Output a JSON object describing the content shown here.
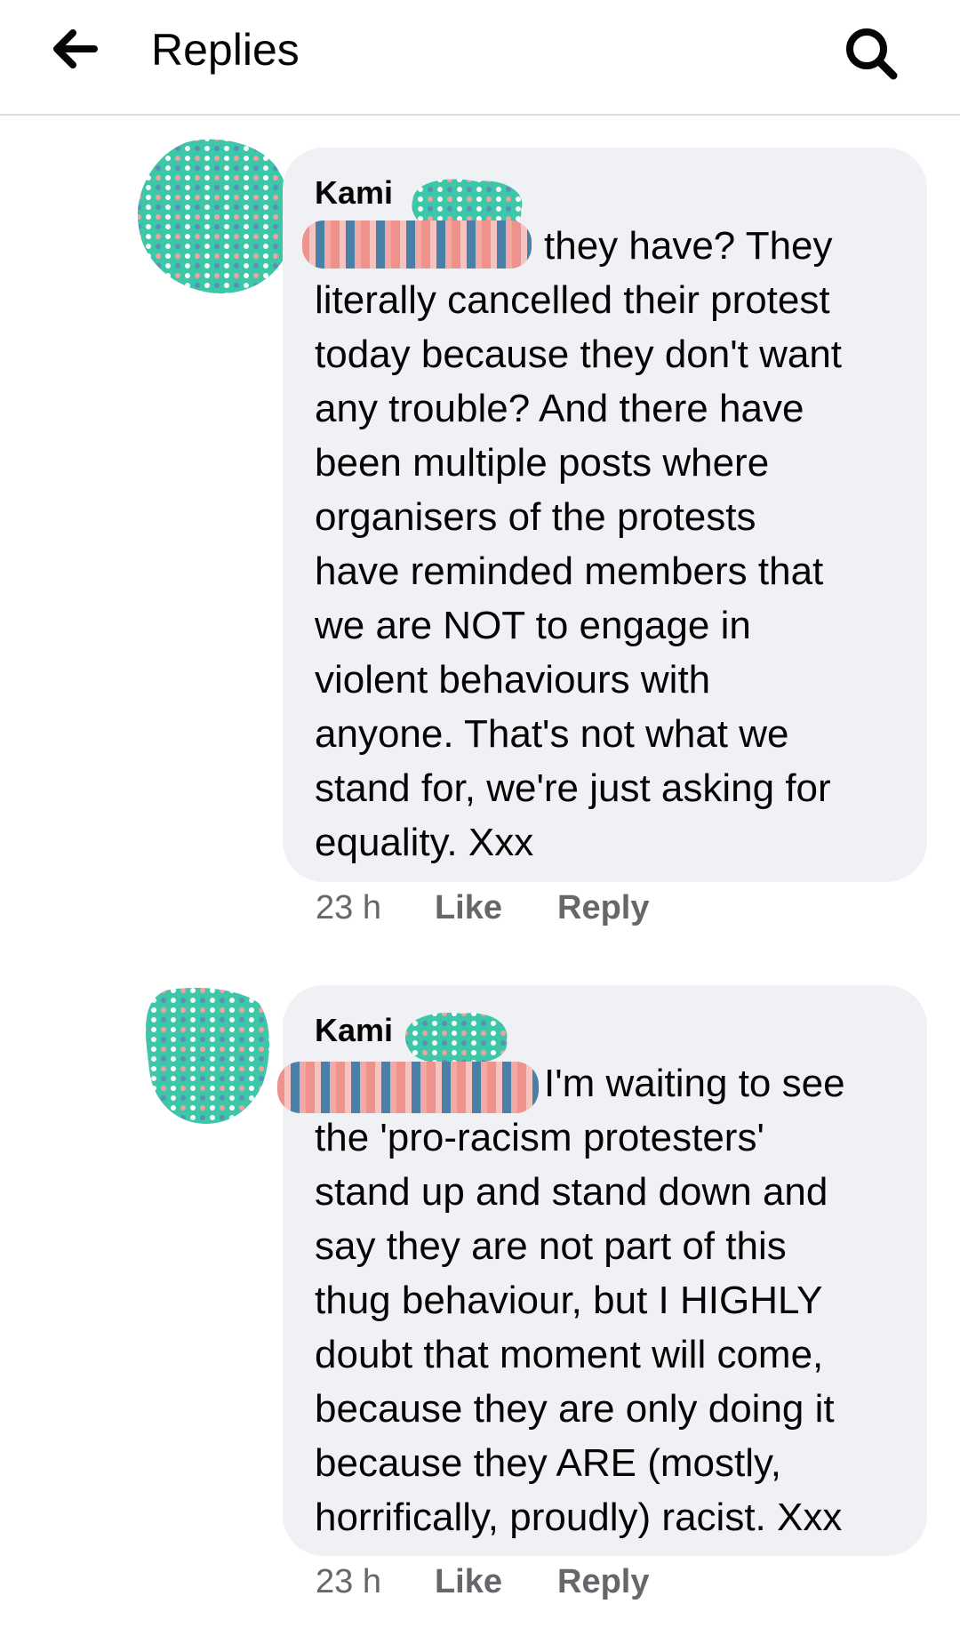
{
  "header": {
    "title": "Replies",
    "back_icon": "arrow-left-icon",
    "search_icon": "search-icon"
  },
  "colors": {
    "bubble_bg": "#f0f1f4",
    "meta_text": "#65676b",
    "redaction_teal": "#3cc7a8",
    "redaction_stripe_pink": "#f0928c",
    "redaction_stripe_blue": "#4a7fa8"
  },
  "comments": [
    {
      "author": "Kami",
      "text": "they have? They\nliterally cancelled their protest\ntoday because they don't want\nany trouble? And there have\nbeen multiple posts where\norganisers of the protests\nhave reminded members that\nwe are NOT to engage in\nviolent behaviours with\nanyone. That's not what we\nstand for, we're just asking for\nequality. Xxx",
      "time": "23 h",
      "like_label": "Like",
      "reply_label": "Reply"
    },
    {
      "author": "Kami",
      "text": "I'm waiting to see\nthe 'pro-racism protesters'\nstand up and stand down and\nsay they are not part of this\nthug behaviour, but I HIGHLY\ndoubt that moment will come,\nbecause they are only doing it\nbecause they ARE (mostly,\nhorrifically, proudly) racist. Xxx",
      "time": "23 h",
      "like_label": "Like",
      "reply_label": "Reply"
    }
  ]
}
